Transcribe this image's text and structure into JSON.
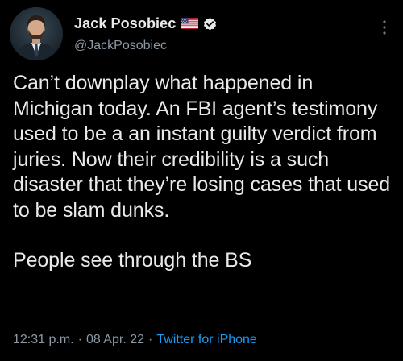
{
  "author": {
    "display_name": "Jack Posobiec",
    "handle": "@JackPosobiec",
    "avatar_icon": "user-avatar",
    "flag_icon": "us-flag-icon",
    "verified_icon": "verified-badge-icon"
  },
  "tweet": {
    "paragraphs": [
      "Can’t downplay what happened in Michigan today. An FBI agent’s testimony used to be a an instant guilty verdict from juries. Now their credibility is a such disaster that they’re losing cases that used to be slam dunks.",
      "People see through the BS"
    ]
  },
  "meta": {
    "time": "12:31 p.m.",
    "date": "08 Apr. 22",
    "separator": "·",
    "source": "Twitter for iPhone"
  },
  "colors": {
    "background": "#000000",
    "text": "#e7e9ea",
    "secondary_text": "#8b98a5",
    "link": "#1d9bf0"
  }
}
